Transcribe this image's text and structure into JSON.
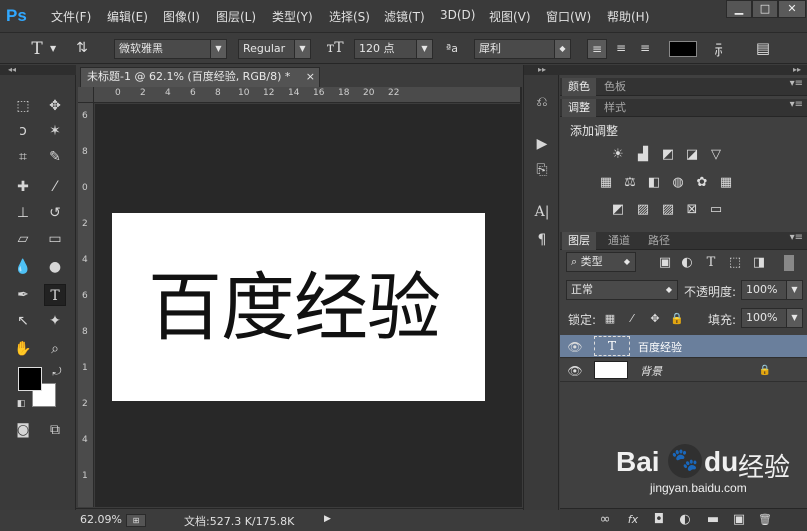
{
  "app": {
    "logo": "Ps",
    "accent": "#31a8ff"
  },
  "menu": [
    "文件(F)",
    "编辑(E)",
    "图像(I)",
    "图层(L)",
    "类型(Y)",
    "选择(S)",
    "滤镜(T)",
    "3D(D)",
    "视图(V)",
    "窗口(W)",
    "帮助(H)"
  ],
  "window_controls": {
    "minimize": "▁",
    "maximize": "□",
    "close": "✕"
  },
  "options": {
    "tool_glyph": "T",
    "font_family": "微软雅黑",
    "font_style": "Regular",
    "font_size": "120 点",
    "aa_label": "ªa",
    "aa_mode": "犀利",
    "text_color": "#000000"
  },
  "document": {
    "tab_title": "未标题-1 @ 62.1% (百度经验, RGB/8) *",
    "tab_close": "×",
    "content_text": "百度经验",
    "ruler_h_ticks": [
      "0",
      "2",
      "4",
      "6",
      "8",
      "10",
      "12",
      "14",
      "16",
      "18",
      "20",
      "22"
    ],
    "ruler_v_ticks": [
      "6",
      "8",
      "0",
      "2",
      "4",
      "6",
      "8",
      "1",
      "2",
      "4",
      "1"
    ]
  },
  "status": {
    "zoom": "62.09%",
    "doc_info": "文档:527.3 K/175.8K",
    "arrow": "▶"
  },
  "panels": {
    "top_tabs": [
      "颜色",
      "色板"
    ],
    "adjust_tabs": [
      "调整",
      "样式"
    ],
    "adjust_title": "添加调整",
    "layer_tabs": [
      "图层",
      "通道",
      "路径"
    ],
    "filter_kind": "类型",
    "blend_mode": "正常",
    "opacity_label": "不透明度:",
    "opacity_value": "100%",
    "lock_label": "锁定:",
    "fill_label": "填充:",
    "fill_value": "100%",
    "layers": [
      {
        "name": "百度经验",
        "type": "text",
        "thumb": "T",
        "selected": true
      },
      {
        "name": "背景",
        "type": "background",
        "thumb": "",
        "selected": false
      }
    ],
    "footer_icons": [
      "∞",
      "fx",
      "◘",
      "◐",
      "▬",
      "▣",
      "🗑"
    ]
  },
  "watermark": {
    "brand": "Bai",
    "brand2": "du",
    "text": "经验",
    "url": "jingyan.baidu.com"
  }
}
